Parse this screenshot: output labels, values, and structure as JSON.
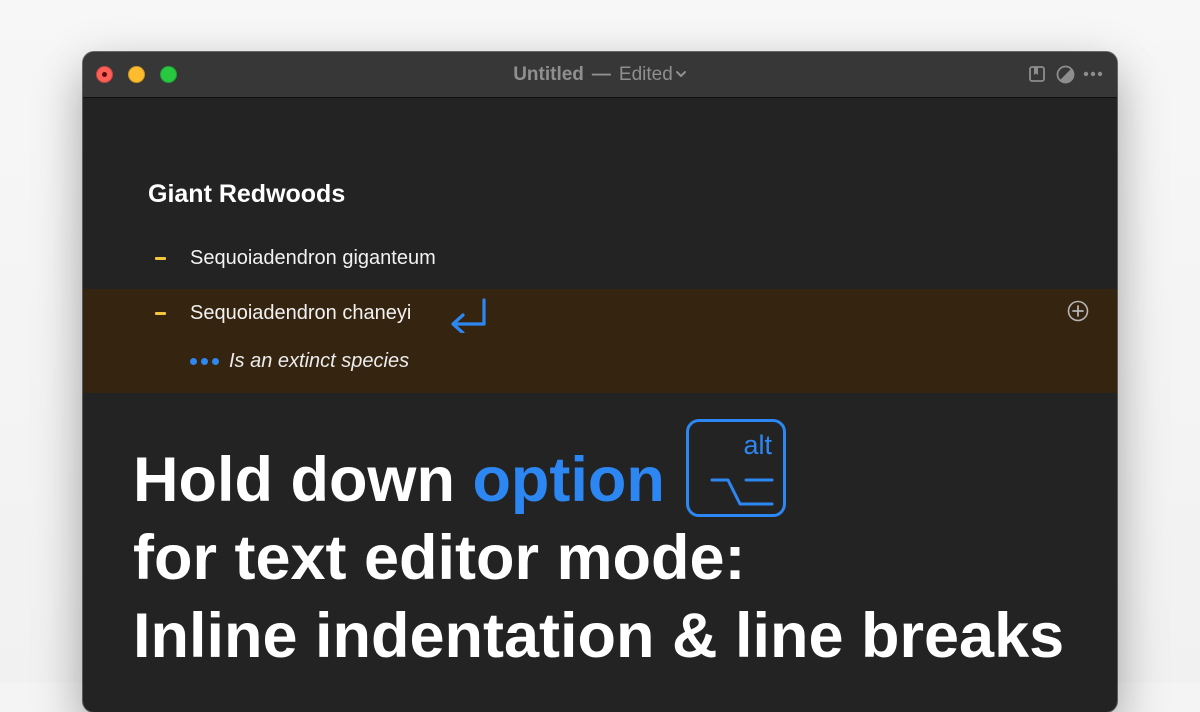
{
  "window": {
    "title": "Untitled",
    "separator": "—",
    "status": "Edited"
  },
  "titlebar_icons": [
    "bookmark-icon",
    "appearance-icon",
    "more-icon"
  ],
  "document": {
    "title": "Giant Redwoods",
    "items": [
      {
        "text": "Sequoiadendron giganteum"
      },
      {
        "text": "Sequoiadendron chaneyi"
      }
    ],
    "note": "Is an extinct species"
  },
  "headline": {
    "line1_prefix": "Hold down ",
    "line1_accent": "option",
    "line2": "for text editor mode:",
    "line3": "Inline indentation & line breaks"
  },
  "option_key": {
    "label": "alt",
    "icon": "option-key-icon"
  },
  "colors": {
    "accent": "#2d87f3",
    "bullet": "#f4c63e",
    "highlight": "#35240f",
    "background": "#232323"
  }
}
